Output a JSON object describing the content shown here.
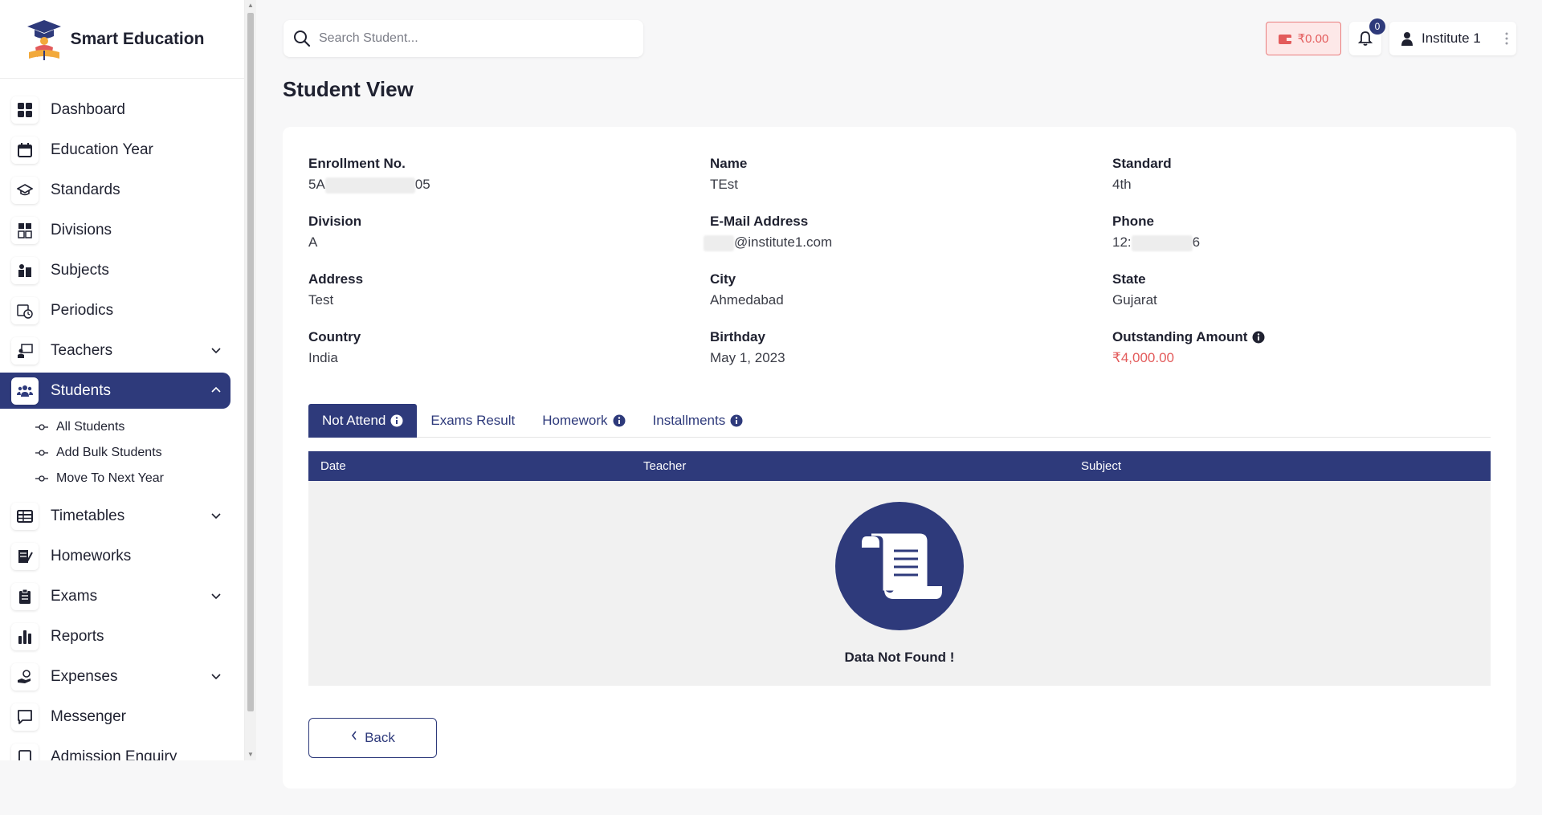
{
  "brand": {
    "name": "Smart Education"
  },
  "sidebar": {
    "items": [
      {
        "label": "Dashboard",
        "icon": "dashboard-icon"
      },
      {
        "label": "Education Year",
        "icon": "calendar-icon"
      },
      {
        "label": "Standards",
        "icon": "graduation-cap-icon"
      },
      {
        "label": "Divisions",
        "icon": "divisions-icon"
      },
      {
        "label": "Subjects",
        "icon": "books-icon"
      },
      {
        "label": "Periodics",
        "icon": "calendar-clock-icon"
      },
      {
        "label": "Teachers",
        "icon": "teacher-board-icon"
      },
      {
        "label": "Students",
        "icon": "users-icon"
      },
      {
        "label": "Timetables",
        "icon": "table-icon"
      },
      {
        "label": "Homeworks",
        "icon": "homework-icon"
      },
      {
        "label": "Exams",
        "icon": "clipboard-icon"
      },
      {
        "label": "Reports",
        "icon": "bar-chart-icon"
      },
      {
        "label": "Expenses",
        "icon": "hand-money-icon"
      },
      {
        "label": "Messenger",
        "icon": "message-icon"
      },
      {
        "label": "Admission Enquiry",
        "icon": "enquiry-icon"
      }
    ],
    "students_sub": [
      "All Students",
      "Add Bulk Students",
      "Move To Next Year"
    ]
  },
  "topbar": {
    "search_placeholder": "Search Student...",
    "wallet_amount": "₹0.00",
    "notification_count": "0",
    "user_name": "Institute 1"
  },
  "page": {
    "title": "Student View"
  },
  "student": {
    "enrollment": {
      "label": "Enrollment No.",
      "prefix": "5A",
      "suffix": "05"
    },
    "name": {
      "label": "Name",
      "value": "TEst"
    },
    "standard": {
      "label": "Standard",
      "value": "4th"
    },
    "division": {
      "label": "Division",
      "value": "A"
    },
    "email": {
      "label": "E-Mail Address",
      "suffix": "@institute1.com"
    },
    "phone": {
      "label": "Phone",
      "prefix": "12:",
      "suffix": "6"
    },
    "address": {
      "label": "Address",
      "value": "Test"
    },
    "city": {
      "label": "City",
      "value": "Ahmedabad"
    },
    "state": {
      "label": "State",
      "value": "Gujarat"
    },
    "country": {
      "label": "Country",
      "value": "India"
    },
    "birthday": {
      "label": "Birthday",
      "value": "May 1, 2023"
    },
    "outstanding": {
      "label": "Outstanding Amount",
      "value": "₹4,000.00"
    }
  },
  "tabs": [
    "Not Attend",
    "Exams Result",
    "Homework",
    "Installments"
  ],
  "table": {
    "headers": [
      "Date",
      "Teacher",
      "Subject"
    ],
    "empty_text": "Data Not Found !"
  },
  "back_label": "Back",
  "colors": {
    "primary": "#2e3a7b",
    "danger": "#e35b5b"
  }
}
